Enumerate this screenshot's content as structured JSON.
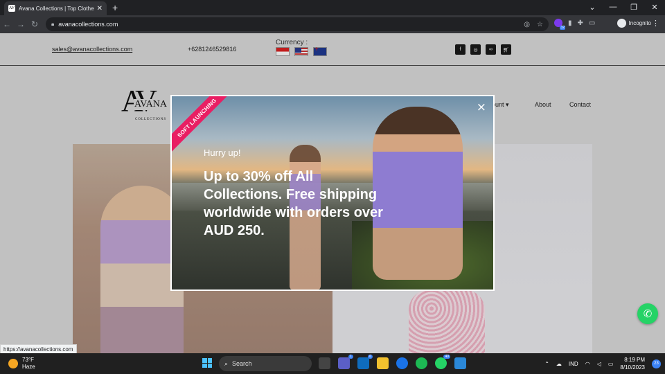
{
  "browser": {
    "tab_title": "Avana Collections | Top Clothes C",
    "url": "avanacollections.com",
    "profile": "Incognito",
    "ext_badge": "32"
  },
  "site": {
    "email": "sales@avanacollections.com",
    "phone": "+6281246529816",
    "currency_label": "Currency :",
    "logo": {
      "mark": "AV",
      "name": "AVANA",
      "sub": "COLLECTIONS"
    },
    "nav": {
      "account": "ount",
      "about": "About",
      "contact": "Contact"
    }
  },
  "popup": {
    "ribbon": "SOFT LAUNCHING",
    "close": "×",
    "kicker": "Hurry up!",
    "headline": "Up to 30% off All Collections. Free shipping worldwide with orders over AUD 250."
  },
  "status_url": "https://avanacollections.com",
  "taskbar": {
    "temp": "73°F",
    "condition": "Haze",
    "search": "Search",
    "lang": "IND",
    "time": "8:19 PM",
    "date": "8/10/2023",
    "notifications": "23",
    "badges": {
      "chat": "1",
      "mail": "6",
      "whatsapp": "40"
    }
  }
}
